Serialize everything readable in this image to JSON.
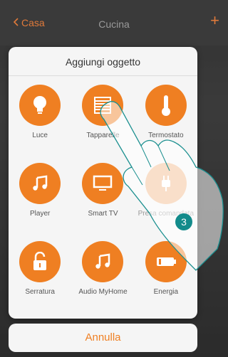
{
  "nav": {
    "back_label": "Casa",
    "title": "Cucina",
    "add_symbol": "+"
  },
  "modal": {
    "title": "Aggiungi oggetto",
    "items": [
      {
        "label": "Luce",
        "icon": "bulb-icon"
      },
      {
        "label": "Tapparelle",
        "icon": "shutter-icon"
      },
      {
        "label": "Termostato",
        "icon": "thermometer-icon"
      },
      {
        "label": "Player",
        "icon": "music-note-icon"
      },
      {
        "label": "Smart TV",
        "icon": "tv-icon"
      },
      {
        "label": "Presa comandata",
        "icon": "plug-icon"
      },
      {
        "label": "Serratura",
        "icon": "lock-icon"
      },
      {
        "label": "Audio MyHome",
        "icon": "music-note-icon"
      },
      {
        "label": "Energia",
        "icon": "battery-icon"
      }
    ],
    "cancel_label": "Annulla"
  },
  "step_badge": "3",
  "colors": {
    "accent": "#ef7f22",
    "header_bg": "#3a3a3a",
    "badge": "#138b8b"
  }
}
